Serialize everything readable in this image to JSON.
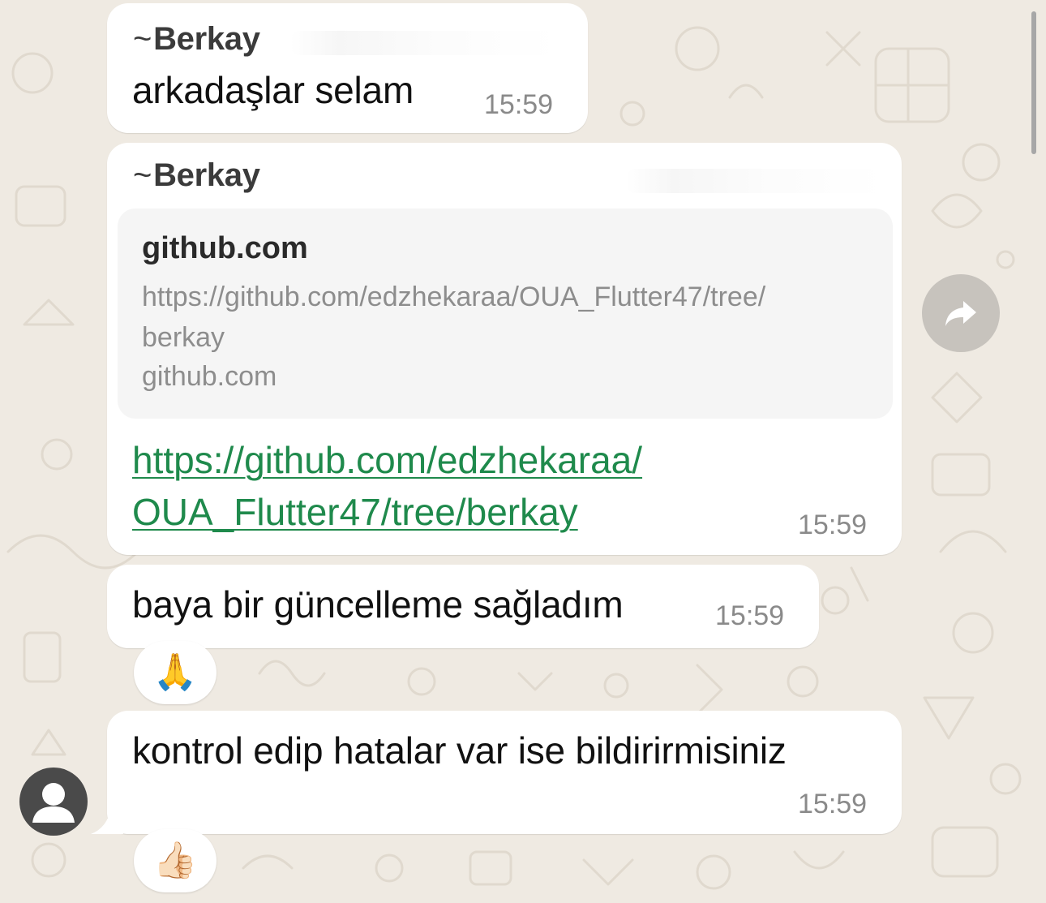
{
  "theme": {
    "background": "#efeae2",
    "bubble": "#ffffff",
    "link_color": "#1f8a4c",
    "time_color": "#8a8a8a",
    "preview_bg": "#f5f5f5"
  },
  "messages": [
    {
      "sender": "Berkay",
      "sender_prefix": "~",
      "text": "arkadaşlar selam",
      "time": "15:59"
    },
    {
      "sender": "Berkay",
      "sender_prefix": "~",
      "preview": {
        "title": "github.com",
        "description": "https://github.com/edzhekaraa/OUA_Flutter47/tree/\nberkay",
        "domain": "github.com"
      },
      "link_line1": "https://github.com/edzhekaraa/",
      "link_line2": "OUA_Flutter47/tree/berkay",
      "time": "15:59",
      "action_icon": "forward-icon"
    },
    {
      "text": "baya bir güncelleme sağladım",
      "time": "15:59",
      "reaction": "🙏"
    },
    {
      "text": "kontrol edip hatalar var ise bildirirmisiniz",
      "time": "15:59",
      "reaction": "👍🏻"
    }
  ],
  "avatar_icon": "default-person-icon"
}
